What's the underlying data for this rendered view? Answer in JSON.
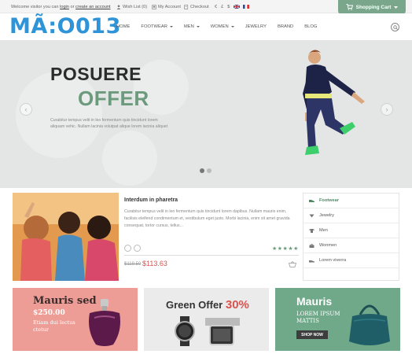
{
  "topbar": {
    "welcome": "Welcome visitor you can",
    "login": "login",
    "or": "or",
    "create_account": "create an account",
    "wishlist": "Wish List (0)",
    "account": "My Account",
    "checkout": "Checkout",
    "currencies": [
      "€",
      "£",
      "$"
    ],
    "cart_label": "Shopping Cart"
  },
  "header": {
    "brand": "MÃ:O013",
    "nav": [
      {
        "label": "HOME",
        "dropdown": false
      },
      {
        "label": "FOOTWEAR",
        "dropdown": true
      },
      {
        "label": "MEN",
        "dropdown": true
      },
      {
        "label": "WOMEN",
        "dropdown": true
      },
      {
        "label": "JEWELRY",
        "dropdown": false
      },
      {
        "label": "BRAND",
        "dropdown": false
      },
      {
        "label": "BLOG",
        "dropdown": false
      }
    ]
  },
  "hero": {
    "title1": "POSUERE",
    "title2": "OFFER",
    "text": "Curabitur tempus velit in leo fermentum quis tincidunt lorem aliquam vehic. Nullam lacinia volutpat alique lorem lacinia aliquet",
    "prev": "‹",
    "next": "›"
  },
  "product": {
    "title": "Interdum in pharetra",
    "text": "Curabitur tempus velit in leo fermentum quis tincidunt lorem dapibus. Nullam mauris enim, facilisis eleifend condimentum et, vestibulum eget justo. Morbi lacinia, enim sit amet gravida consequat, tortor cursus, tellus...",
    "stars": "★★★★★",
    "old_price": "$119.50",
    "new_price": "$113.63"
  },
  "categories": [
    {
      "label": "Footwear",
      "active": true
    },
    {
      "label": "Jewelry",
      "active": false
    },
    {
      "label": "Men",
      "active": false
    },
    {
      "label": "Wonmen",
      "active": false
    },
    {
      "label": "Lorem viverra",
      "active": false
    }
  ],
  "banners": {
    "b1": {
      "title": "Mauris sed",
      "price": "$250.00",
      "sub": "Etiam dui lectus ctetur"
    },
    "b2": {
      "title": "Green Offer",
      "pct": "30%"
    },
    "b3": {
      "title": "Mauris",
      "sub": "LOREM IPSUM MATTIS",
      "button": "SHOP NOW"
    }
  },
  "colors": {
    "accent_green": "#6fa98a",
    "brand_blue": "#2f93d8",
    "sale_red": "#d9534f",
    "pink_banner": "#ee9d96"
  }
}
